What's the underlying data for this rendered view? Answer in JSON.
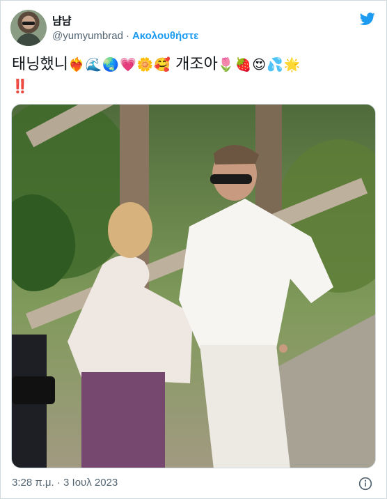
{
  "tweet": {
    "display_name": "냠냠",
    "handle": "@yumyumbrad",
    "separator": "·",
    "follow_label": "Ακολουθήστε",
    "text_korean_1": "태닝했니",
    "text_korean_2": "개조아",
    "emojis_1": [
      "❤️‍🔥",
      "🌊",
      "🌏",
      "💗",
      "🌼",
      "🥰"
    ],
    "emojis_2": [
      "🌷",
      "🍓",
      "😍",
      "💦",
      "🌟"
    ],
    "emojis_3": "‼️",
    "timestamp": "3:28 π.μ. · 3 Ιουλ 2023"
  },
  "icons": {
    "brand": "twitter-bird-icon",
    "info": "info-icon"
  },
  "colors": {
    "accent": "#1d9bf0",
    "secondary_text": "#536471",
    "border": "#cfd9de"
  }
}
